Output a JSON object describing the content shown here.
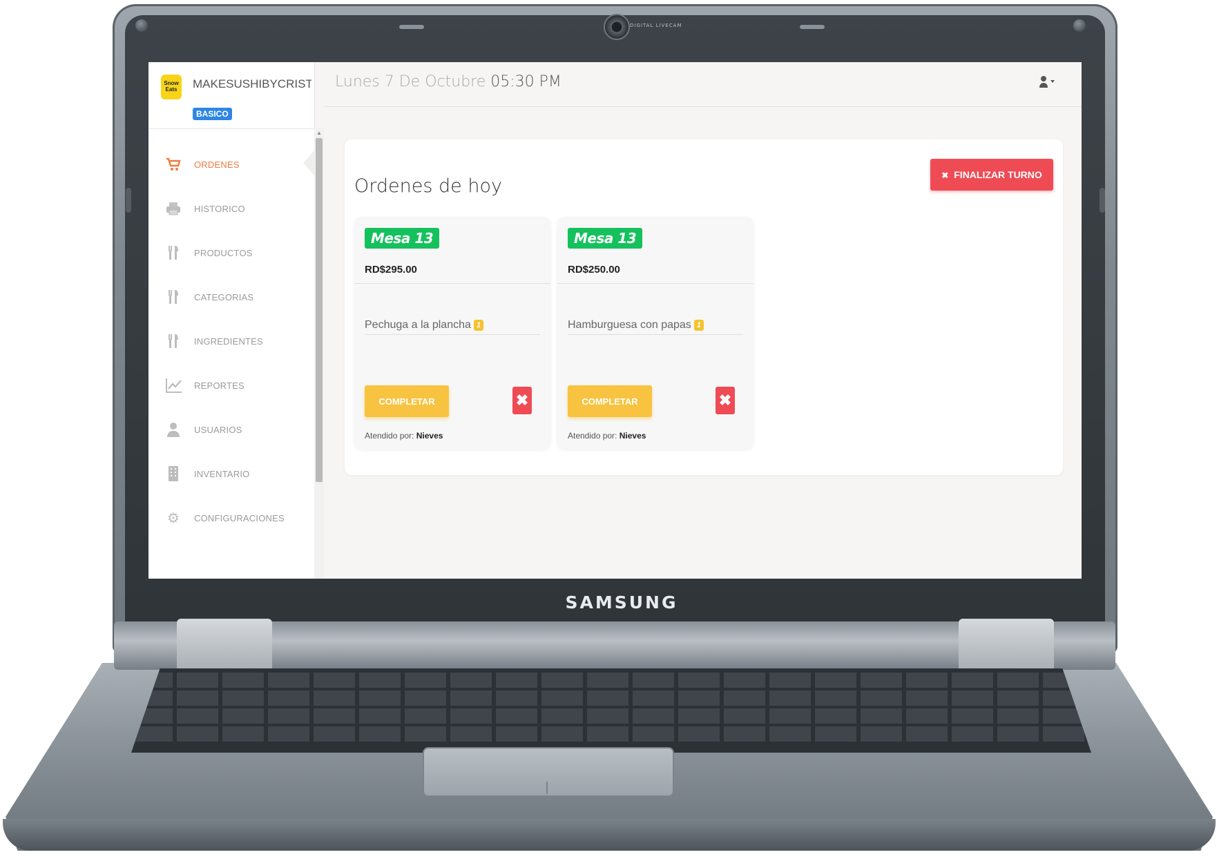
{
  "laptop": {
    "brand": "SAMSUNG",
    "webcam_label": "DIGITAL LIVECAM"
  },
  "app": {
    "logo_text": "Snow Eats",
    "business_name": "MAKESUSHIBYCRISTINA",
    "plan_badge": "BASICO"
  },
  "sidebar": {
    "items": [
      {
        "label": "ORDENES",
        "icon": "cart-icon",
        "active": true
      },
      {
        "label": "HISTORICO",
        "icon": "printer-icon",
        "active": false
      },
      {
        "label": "PRODUCTOS",
        "icon": "utensils-icon",
        "active": false
      },
      {
        "label": "CATEGORIAS",
        "icon": "utensils-icon",
        "active": false
      },
      {
        "label": "INGREDIENTES",
        "icon": "utensils-icon",
        "active": false
      },
      {
        "label": "REPORTES",
        "icon": "line-chart-icon",
        "active": false
      },
      {
        "label": "USUARIOS",
        "icon": "user-icon",
        "active": false
      },
      {
        "label": "INVENTARIO",
        "icon": "building-icon",
        "active": false
      },
      {
        "label": "CONFIGURACIONES",
        "icon": "gear-icon",
        "active": false
      }
    ]
  },
  "header": {
    "date": "Lunes 7 De Octubre",
    "time": "05:30 PM",
    "user_icon": "user-dropdown-icon"
  },
  "main": {
    "title": "Ordenes de hoy",
    "end_shift_label": "FINALIZAR TURNO",
    "orders": [
      {
        "table": "Mesa 13",
        "total": "RD$295.00",
        "item": "Pechuga a la plancha",
        "qty": "1",
        "complete_label": "COMPLETAR",
        "served_by_label": "Atendido por:",
        "served_by": "Nieves"
      },
      {
        "table": "Mesa 13",
        "total": "RD$250.00",
        "item": "Hamburguesa con papas",
        "qty": "1",
        "complete_label": "COMPLETAR",
        "served_by_label": "Atendido por:",
        "served_by": "Nieves"
      }
    ]
  },
  "colors": {
    "accent_orange": "#f07a3d",
    "danger_red": "#ef4b55",
    "success_green": "#15c15d",
    "warning_yellow": "#f8c340",
    "plan_blue": "#2e86e6"
  }
}
